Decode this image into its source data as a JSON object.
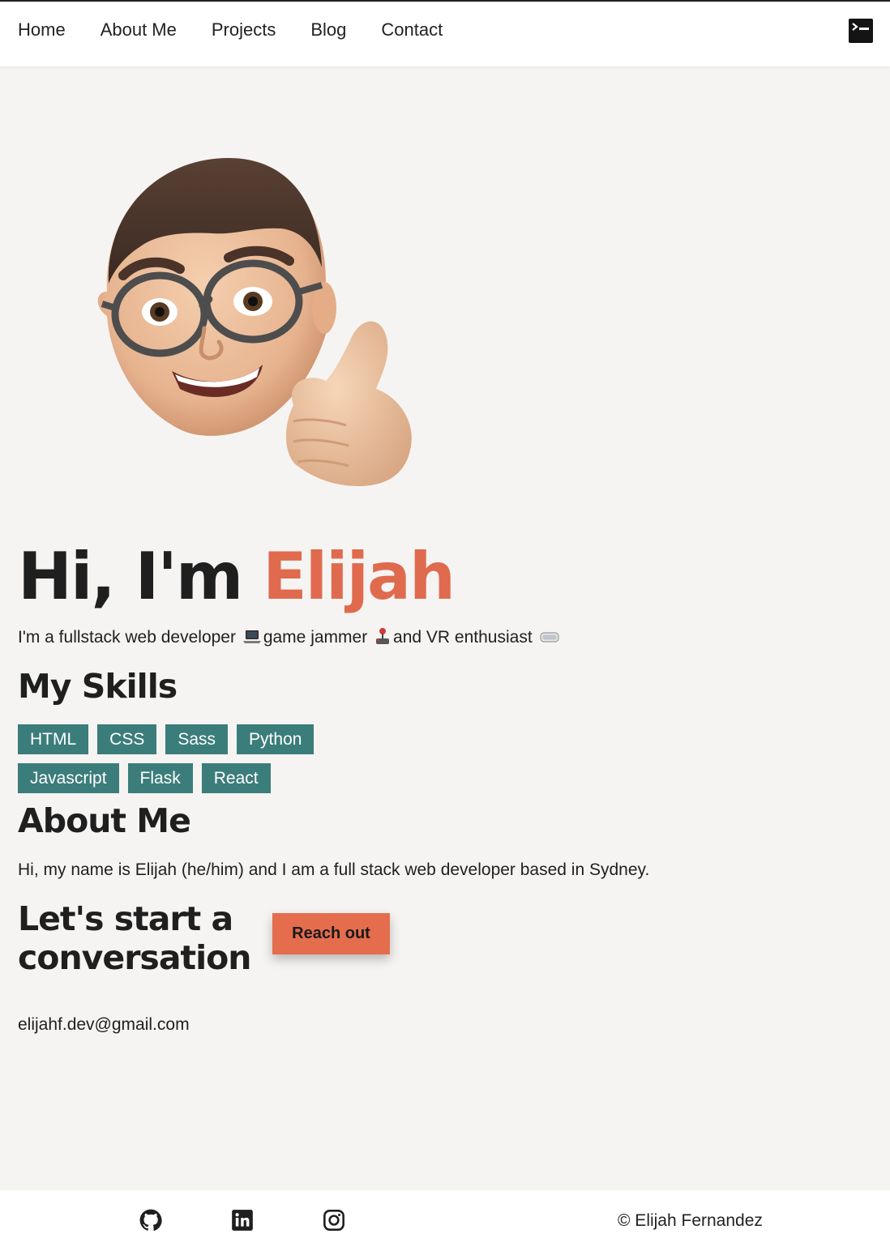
{
  "nav": {
    "links": [
      "Home",
      "About Me",
      "Projects",
      "Blog",
      "Contact"
    ],
    "terminal_icon": "terminal-icon"
  },
  "hero": {
    "greeting": "Hi, I'm ",
    "name": "Elijah",
    "tagline": {
      "part1": "I'm a fullstack web developer",
      "part2": "game jammer",
      "part3": "and VR enthusiast"
    },
    "avatar_icon": "memoji-thumbs-up-avatar"
  },
  "skills": {
    "title": "My Skills",
    "row1": [
      "HTML",
      "CSS",
      "Sass",
      "Python"
    ],
    "row2": [
      "Javascript",
      "Flask",
      "React"
    ]
  },
  "about": {
    "title": "About Me",
    "text": "Hi, my name is Elijah (he/him) and I am a full stack web developer based in Sydney."
  },
  "contact": {
    "title": "Let's start a conversation",
    "button_label": "Reach out",
    "email": "elijahf.dev@gmail.com"
  },
  "footer": {
    "icons": [
      "github-icon",
      "linkedin-icon",
      "instagram-icon"
    ],
    "copyright": "© Elijah Fernandez"
  },
  "colors": {
    "accent": "#e06a4e",
    "skill_bg": "#3b7d7b",
    "page_bg": "#f5f4f2",
    "button_bg": "#e46d4e"
  }
}
